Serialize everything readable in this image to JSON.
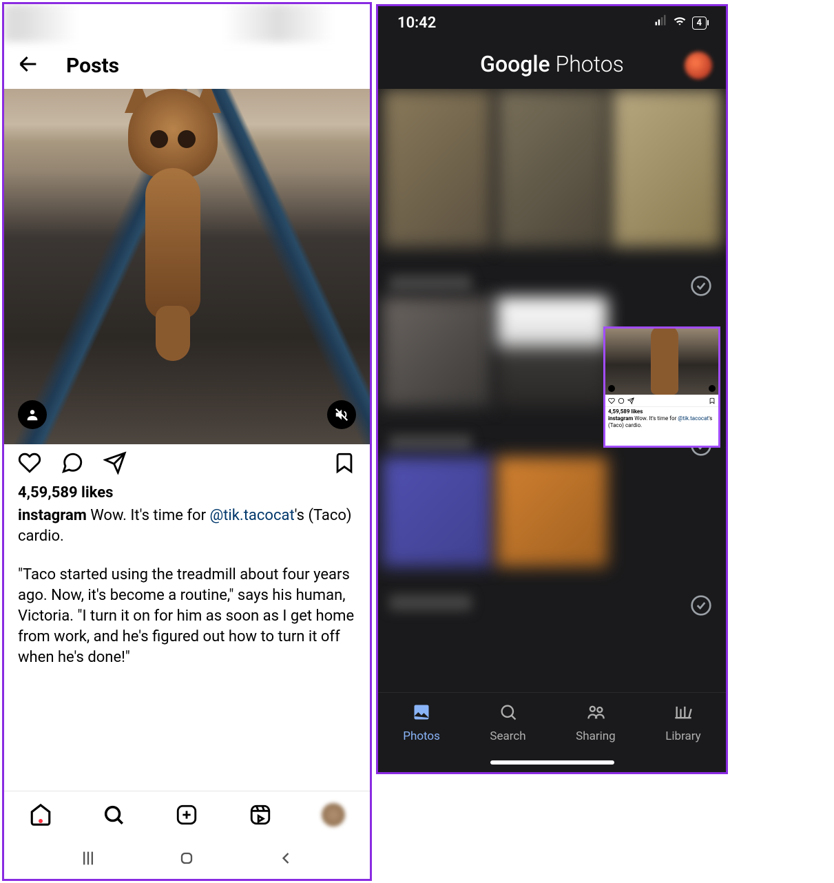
{
  "instagram": {
    "header": {
      "title": "Posts"
    },
    "post": {
      "likes_text": "4,59,589 likes",
      "author": "instagram",
      "caption_lead": " Wow. It's time for ",
      "mention": "@tik.tacocat",
      "caption_tail": "'s (Taco) cardio.",
      "caption_body": "\"Taco started using the treadmill about four years ago. Now, it's become a routine,\" says his human, Victoria. \"I turn it on for him as soon as I get home from work, and he's figured out how to turn it off when he's done!\""
    }
  },
  "google_photos": {
    "status": {
      "time": "10:42",
      "battery": "4"
    },
    "header": {
      "brand_bold": "Google",
      "brand_thin": " Photos"
    },
    "highlight": {
      "likes": "4,59,589 likes",
      "author": "instagram",
      "text_lead": " Wow. It's time for ",
      "mention": "@tik.tacocat",
      "text_tail": "'s (Taco) cardio."
    },
    "nav": {
      "photos": "Photos",
      "search": "Search",
      "sharing": "Sharing",
      "library": "Library"
    }
  }
}
